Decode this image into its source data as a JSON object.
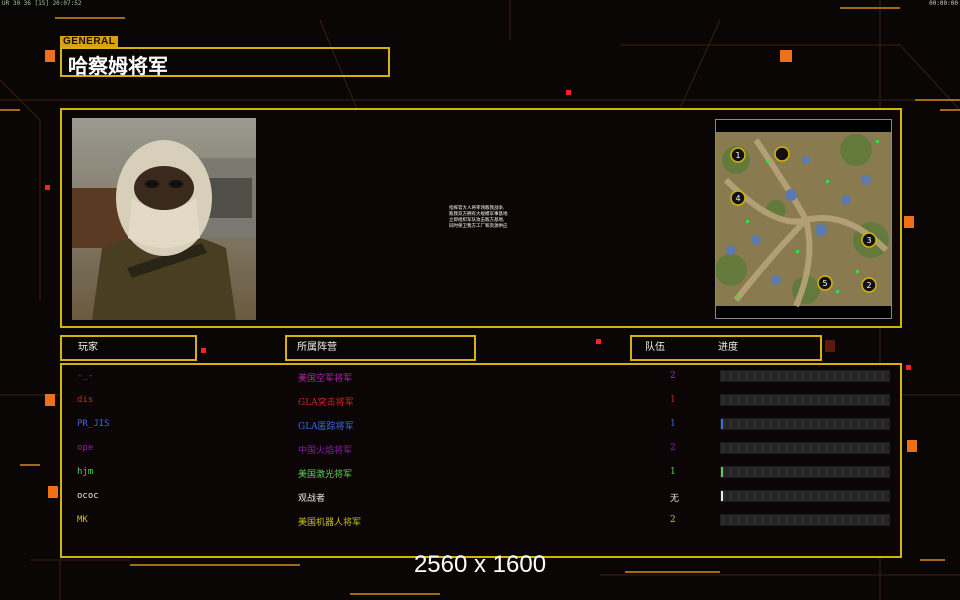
{
  "hud": {
    "fps": "UR 30 36 [15] 20:07:52",
    "clock": "00:00:00"
  },
  "general_tag": "GENERAL",
  "general_name": "哈察姆将军",
  "briefing_lines": [
    "指挥官大人将率领敌我战争,",
    "敌我双方拥有大规模军事基地",
    "立即组织军队攻击敌方基地,",
    "同时保卫我方工厂和资源供应"
  ],
  "minimap": {
    "markers": [
      "1",
      "2",
      "3",
      "4",
      "5"
    ]
  },
  "headers": {
    "player": "玩家",
    "faction": "所属阵营",
    "team": "队伍",
    "progress": "进度"
  },
  "players": [
    {
      "name": "-_-",
      "faction": "美国空军将军",
      "team": "2",
      "color": "#b026b0",
      "progress": 0
    },
    {
      "name": "dis",
      "faction": "GLA突击将军",
      "team": "1",
      "color": "#d42222",
      "progress": 0
    },
    {
      "name": "PR_JIS",
      "faction": "GLA匿踪将军",
      "team": "1",
      "color": "#3a6ae0",
      "progress": 0.01
    },
    {
      "name": "ope",
      "faction": "中国火焰将军",
      "team": "2",
      "color": "#8a1fa8",
      "progress": 0
    },
    {
      "name": "hjm",
      "faction": "美国激光将军",
      "team": "1",
      "color": "#5cd05c",
      "progress": 0.01
    },
    {
      "name": "ococ",
      "faction": "观战者",
      "team": "无",
      "color": "#e8e8e8",
      "progress": 0.01
    },
    {
      "name": "MK",
      "faction": "美国机器人将军",
      "team": "2",
      "color": "#c8c020",
      "progress": 0
    }
  ],
  "resolution": "2560 x 1600"
}
